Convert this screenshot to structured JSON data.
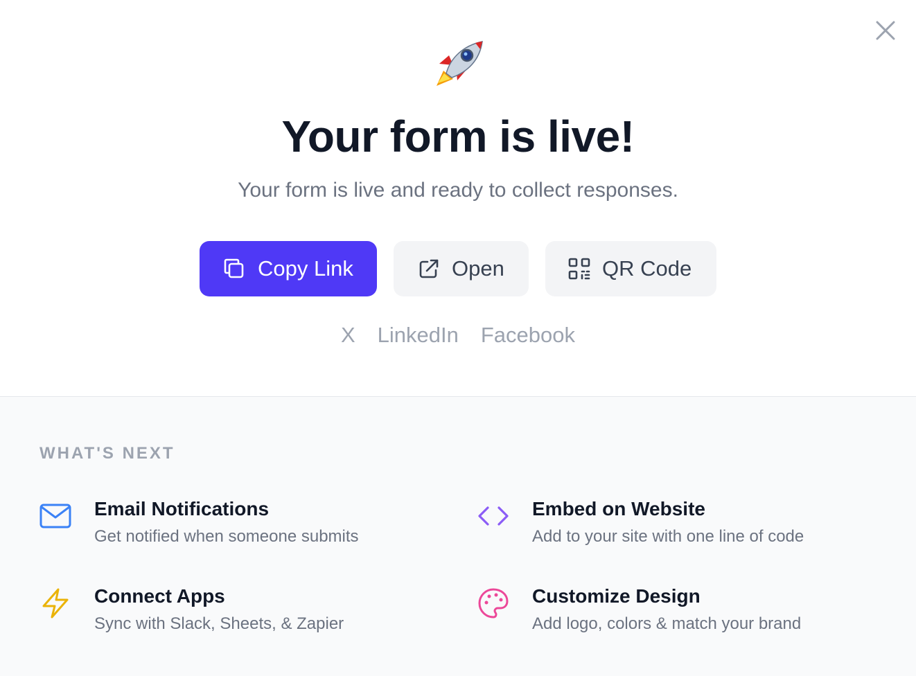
{
  "header": {
    "title": "Your form is live!",
    "subtitle": "Your form is live and ready to collect responses."
  },
  "icons": {
    "close": "close-icon",
    "rocket": "rocket-icon"
  },
  "actions": {
    "copy_link_label": "Copy Link",
    "open_label": "Open",
    "qr_code_label": "QR Code"
  },
  "share": {
    "x_label": "X",
    "linkedin_label": "LinkedIn",
    "facebook_label": "Facebook"
  },
  "whats_next": {
    "label": "WHAT'S NEXT",
    "items": [
      {
        "title": "Email Notifications",
        "description": "Get notified when someone submits",
        "icon": "mail-icon",
        "color": "#3b82f6"
      },
      {
        "title": "Embed on Website",
        "description": "Add to your site with one line of code",
        "icon": "code-icon",
        "color": "#8b5cf6"
      },
      {
        "title": "Connect Apps",
        "description": "Sync with Slack, Sheets, & Zapier",
        "icon": "lightning-icon",
        "color": "#eab308"
      },
      {
        "title": "Customize Design",
        "description": "Add logo, colors & match your brand",
        "icon": "palette-icon",
        "color": "#ec4899"
      }
    ]
  },
  "colors": {
    "primary": "#4f39f6",
    "secondary_bg": "#f3f4f6",
    "muted_text": "#6b7280"
  }
}
